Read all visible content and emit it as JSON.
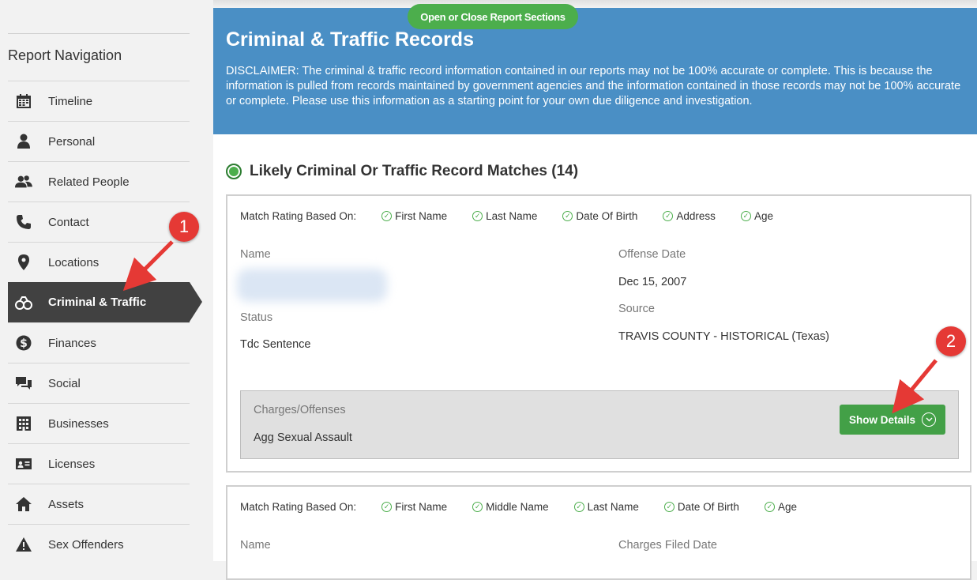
{
  "sidebar": {
    "title": "Report Navigation",
    "items": [
      {
        "label": "Timeline",
        "icon": "calendar-icon"
      },
      {
        "label": "Personal",
        "icon": "person-icon"
      },
      {
        "label": "Related People",
        "icon": "people-icon"
      },
      {
        "label": "Contact",
        "icon": "phone-icon"
      },
      {
        "label": "Locations",
        "icon": "map-pin-icon"
      },
      {
        "label": "Criminal & Traffic",
        "icon": "handcuffs-icon",
        "active": true
      },
      {
        "label": "Finances",
        "icon": "dollar-icon"
      },
      {
        "label": "Social",
        "icon": "chat-icon"
      },
      {
        "label": "Businesses",
        "icon": "building-icon"
      },
      {
        "label": "Licenses",
        "icon": "id-card-icon"
      },
      {
        "label": "Assets",
        "icon": "home-icon"
      },
      {
        "label": "Sex Offenders",
        "icon": "warning-icon"
      }
    ]
  },
  "banner": {
    "toggle_label": "Open or Close Report Sections",
    "title": "Criminal & Traffic Records",
    "disclaimer": "DISCLAIMER: The criminal & traffic record information contained in our reports may not be 100% accurate or complete. This is because the information is pulled from records maintained by government agencies and the information contained in those records may not be 100% accurate or complete. Please use this information as a starting point for your own due diligence and investigation."
  },
  "section": {
    "heading": "Likely Criminal Or Traffic Record Matches (14)"
  },
  "records": [
    {
      "match_label": "Match Rating Based On:",
      "criteria": [
        "First Name",
        "Last Name",
        "Date Of Birth",
        "Address",
        "Age"
      ],
      "name_label": "Name",
      "status_label": "Status",
      "status": "Tdc Sentence",
      "date_label": "Offense Date",
      "date": "Dec 15, 2007",
      "source_label": "Source",
      "source": "TRAVIS COUNTY - HISTORICAL (Texas)",
      "charges_label": "Charges/Offenses",
      "charges": "Agg Sexual Assault",
      "details_button": "Show Details"
    },
    {
      "match_label": "Match Rating Based On:",
      "criteria": [
        "First Name",
        "Middle Name",
        "Last Name",
        "Date Of Birth",
        "Age"
      ],
      "name_label": "Name",
      "date_label": "Charges Filed Date"
    }
  ],
  "annotations": {
    "badge1": "1",
    "badge2": "2",
    "color": "#e53935"
  },
  "colors": {
    "banner": "#4a8fc5",
    "green": "#4cae4c",
    "active_nav": "#414141"
  }
}
